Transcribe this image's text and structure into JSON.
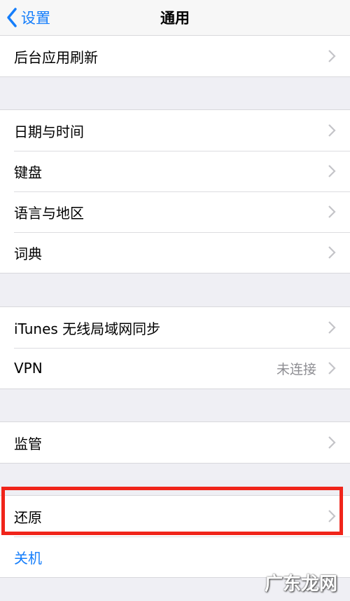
{
  "nav": {
    "back_label": "设置",
    "title": "通用"
  },
  "groups": {
    "g1": [
      "后台应用刷新"
    ],
    "g2": [
      "日期与时间",
      "键盘",
      "语言与地区",
      "词典"
    ],
    "g3": [
      "iTunes 无线局域网同步",
      "VPN"
    ],
    "g4": [
      "监管"
    ],
    "g5": [
      "还原",
      "关机"
    ]
  },
  "values": {
    "vpn_status": "未连接"
  },
  "colors": {
    "accent": "#157efb",
    "highlight": "#f0241a",
    "background": "#efeff4"
  },
  "icons": {
    "back": "chevron-left-icon",
    "disclosure": "chevron-right-icon"
  },
  "watermark": "广东龙网"
}
